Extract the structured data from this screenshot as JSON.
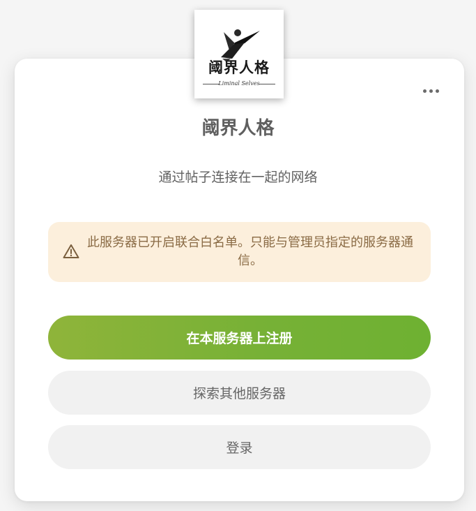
{
  "logo": {
    "title_text": "阈界人格",
    "subtitle_text": "Liminal Selves"
  },
  "app": {
    "title": "阈界人格",
    "tagline": "通过帖子连接在一起的网络"
  },
  "notice": {
    "icon": "warning-icon",
    "text": "此服务器已开启联合白名单。只能与管理员指定的服务器通信。"
  },
  "actions": {
    "register_label": "在本服务器上注册",
    "explore_label": "探索其他服务器",
    "login_label": "登录"
  },
  "menu": {
    "icon": "more-horizontal-icon"
  },
  "colors": {
    "primary_start": "#8fb43a",
    "primary_end": "#6eb132",
    "notice_bg": "#fcefdc",
    "notice_text": "#8a6b45",
    "secondary_bg": "#f1f1f1"
  }
}
